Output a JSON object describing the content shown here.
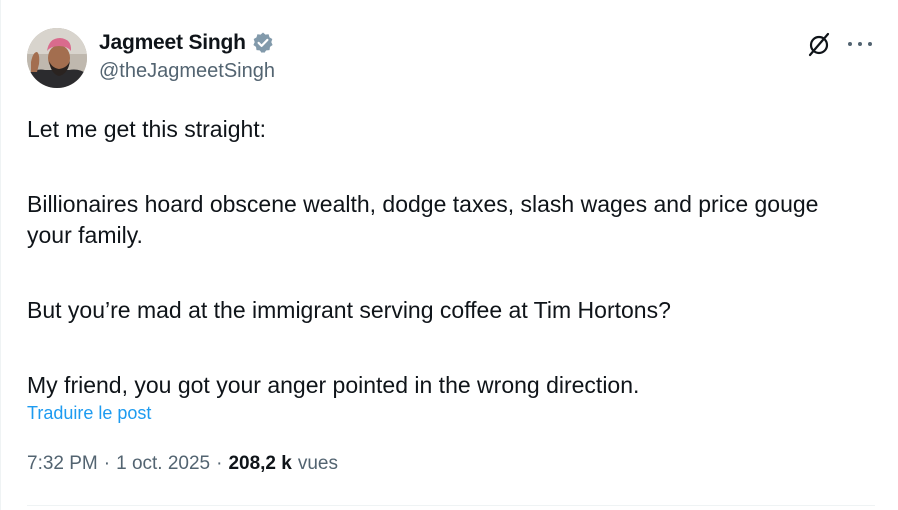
{
  "author": {
    "name": "Jagmeet Singh",
    "handle": "@theJagmeetSingh",
    "verified_badge_color": "#829aab"
  },
  "header": {
    "grok_icon": "grok-slash-circle-icon",
    "more_icon": "more-horizontal-icon"
  },
  "post": {
    "lines": [
      "Let me get this straight:",
      "Billionaires hoard obscene wealth, dodge taxes, slash wages and price gouge your family.",
      "But you’re mad at the immigrant serving coffee at Tim Hortons?",
      "My friend, you got your anger pointed in the wrong direction."
    ],
    "translate_label": "Traduire le post"
  },
  "meta": {
    "time": "7:32 PM",
    "date": "1 oct. 2025",
    "views_count": "208,2 k",
    "views_label": "vues"
  },
  "colors": {
    "text": "#0f1419",
    "secondary": "#536471",
    "link": "#1d9bf0"
  }
}
